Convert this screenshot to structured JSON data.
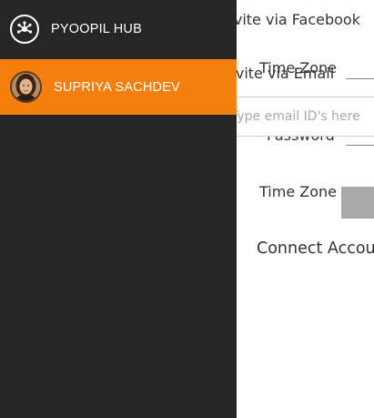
{
  "drawer": {
    "hub": {
      "label": "PYOOPIL HUB",
      "icon": "network-hub-icon"
    },
    "user": {
      "name": "SUPRIYA SACHDEV",
      "icon": "user-avatar"
    },
    "colors": {
      "background": "#262626",
      "active": "#f47f0d"
    }
  },
  "settings": {
    "invite_facebook_label": "Invite via Facebook",
    "time_zone_label_1": "Time Zone",
    "invite_email_label": "Invite via Email",
    "email_placeholder": "Type email ID's here",
    "password_label": "Password",
    "time_zone_label_2": "Time Zone",
    "connect_accounts_label": "Connect Accou"
  }
}
